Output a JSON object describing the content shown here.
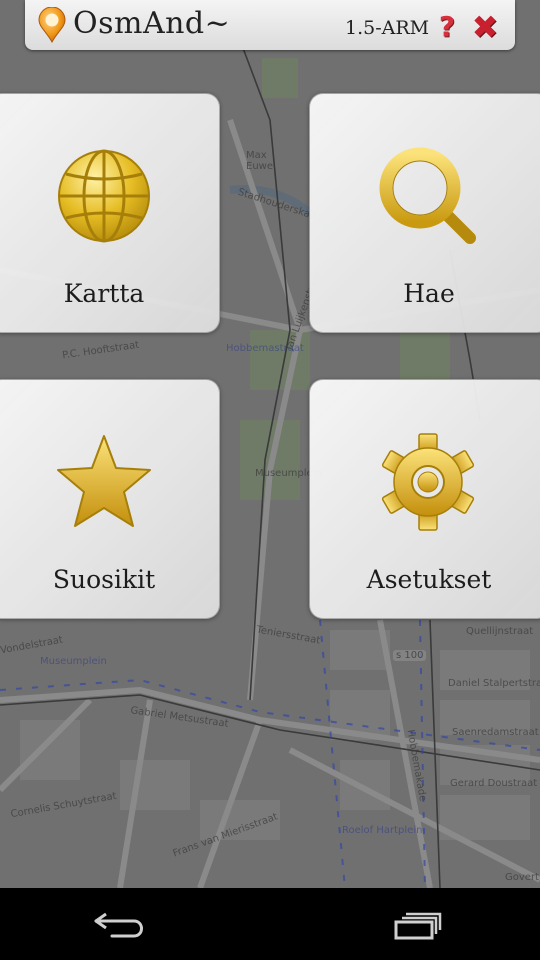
{
  "app": {
    "name": "OsmAnd~",
    "version": "1.5-ARM"
  },
  "titlebar": {
    "icons": [
      "osmand-pin-icon",
      "help-icon",
      "close-icon"
    ],
    "help_glyph": "?",
    "close_glyph": "✖"
  },
  "tiles": [
    {
      "label": "Kartta",
      "icon": "globe-icon"
    },
    {
      "label": "Hae",
      "icon": "magnifier-icon"
    },
    {
      "label": "Suosikit",
      "icon": "star-icon"
    },
    {
      "label": "Asetukset",
      "icon": "gear-icon"
    }
  ],
  "map_labels": [
    "Max Euwe",
    "Stadhouderskade",
    "Jan Luijkenstraat",
    "Hobbemastraat",
    "P.C. Hooftstraat",
    "Museumplein",
    "Museumplein",
    "Gabriel Metsustraat",
    "Teniersstraat",
    "Quellijnstraat",
    "Daniel Stalpertstraat",
    "Saenredamstraat",
    "Gerard Doustraat",
    "Hobbemakade",
    "Frans van Mierisstraat",
    "Cornelis Schuytstraat",
    "Roelof Hartplein",
    "Govert",
    "s 100",
    "Vondelstraat"
  ],
  "navbar": {
    "icons": [
      "back-icon",
      "recent-apps-icon"
    ]
  },
  "colors": {
    "accent_gold": "#e3b61c",
    "title_text": "#222222",
    "help_red": "#d6303d",
    "close_red": "#c8202e",
    "nav_bg": "#000000"
  }
}
